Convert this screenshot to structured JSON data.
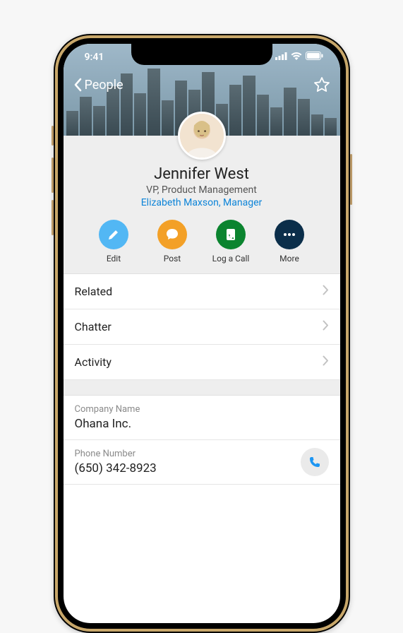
{
  "status": {
    "time": "9:41"
  },
  "nav": {
    "back_label": "People"
  },
  "contact": {
    "name": "Jennifer West",
    "title": "VP, Product Management",
    "manager": "Elizabeth Maxson, Manager"
  },
  "actions": {
    "edit": "Edit",
    "post": "Post",
    "log_call": "Log a Call",
    "more": "More"
  },
  "sections": {
    "related": "Related",
    "chatter": "Chatter",
    "activity": "Activity"
  },
  "fields": {
    "company_label": "Company Name",
    "company_value": "Ohana Inc.",
    "phone_label": "Phone Number",
    "phone_value": "(650) 342-8923"
  }
}
